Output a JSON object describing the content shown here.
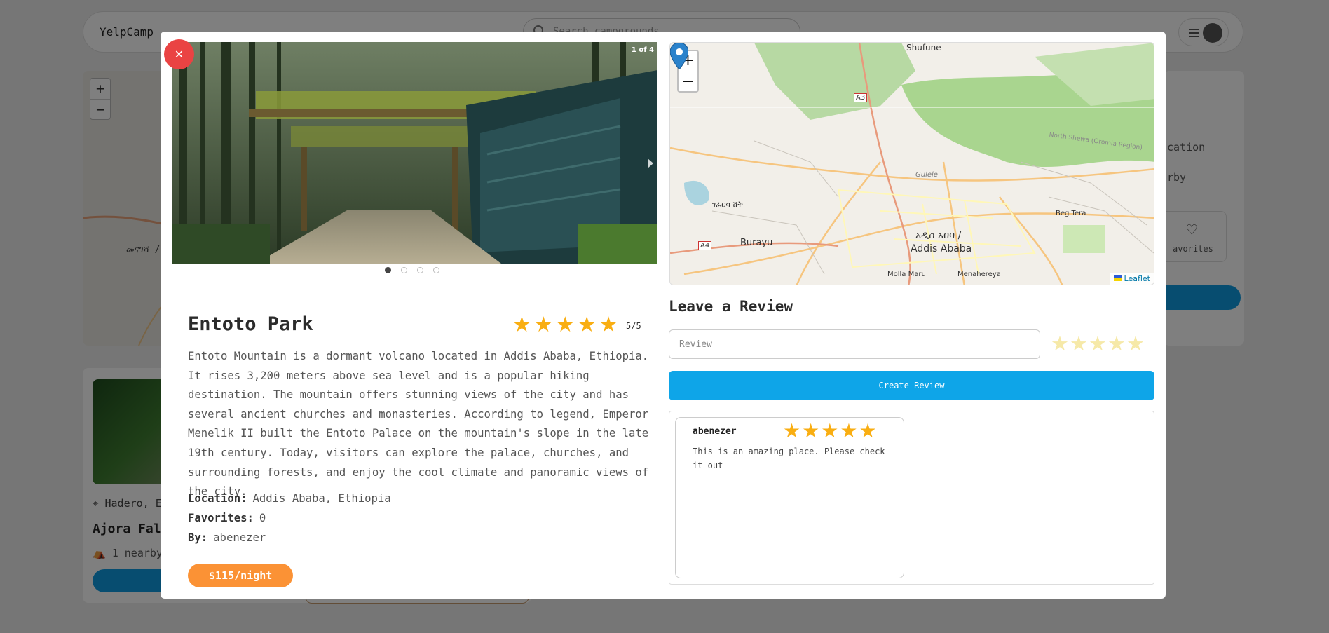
{
  "navbar": {
    "brand": "YelpCamp",
    "search_placeholder": "Search campgrounds..."
  },
  "background": {
    "map_label": "መናገሻ / ...",
    "side_text_1": "cation",
    "side_text_2": "rby",
    "favorites_label": "avorites",
    "card_location": "Hadero, E",
    "card_title": "Ajora Fall",
    "card_nearby": "1 nearby"
  },
  "modal": {
    "close_symbol": "✕",
    "carousel": {
      "counter": "1 of 4",
      "slides": 4,
      "active_slide": 1
    },
    "campground": {
      "title": "Entoto Park",
      "rating": 5,
      "rating_text": "5/5",
      "description": "Entoto Mountain is a dormant volcano located in Addis Ababa, Ethiopia. It rises 3,200 meters above sea level and is a popular hiking destination. The mountain offers stunning views of the city and has several ancient churches and monasteries. According to legend, Emperor Menelik II built the Entoto Palace on the mountain's slope in the late 19th century. Today, visitors can explore the palace, churches, and surrounding forests, and enjoy the cool climate and panoramic views of the city.",
      "location_label": "Location:",
      "location": "Addis Ababa, Ethiopia",
      "favorites_label": "Favorites:",
      "favorites": "0",
      "by_label": "By:",
      "by": "abenezer",
      "price": "$115/night"
    },
    "map": {
      "zoom_in": "+",
      "zoom_out": "−",
      "attribution": "Leaflet",
      "labels": {
        "shufune": "Shufune",
        "a3": "A3",
        "a4": "A4",
        "burayu": "Burayu",
        "addis_am": "አዲስ አበባ /",
        "addis_en": "Addis Ababa",
        "gullele": "Gulele",
        "begtera": "Beg Tera",
        "north_shewa": "North Shewa (Oromia Region)",
        "molla_maru": "Molla Maru",
        "menahereya": "Menahereya",
        "gefersa": "ገፈርሳ ሸት"
      }
    },
    "review_form": {
      "heading": "Leave a Review",
      "placeholder": "Review",
      "button": "Create Review"
    },
    "reviews": [
      {
        "author": "abenezer",
        "rating": 5,
        "body": "This is an amazing place. Please check it out"
      }
    ]
  },
  "colors": {
    "accent_blue": "#0ea5e8",
    "star": "#f9ae12",
    "price": "#fb9235",
    "close": "#ea4343"
  }
}
